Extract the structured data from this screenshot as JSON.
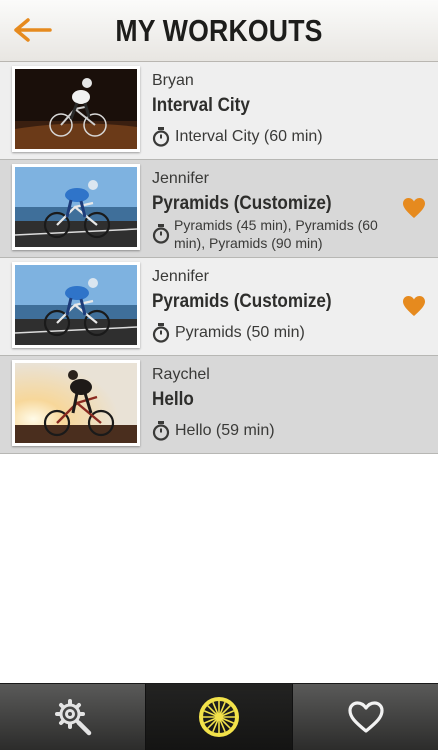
{
  "header": {
    "title": "MY WORKOUTS",
    "back_icon": "arrow-left-icon",
    "accent_color": "#e68a1e"
  },
  "workouts": [
    {
      "author": "Bryan",
      "title": "Interval City",
      "detail": "Interval City (60 min)",
      "favorite": false,
      "thumb_icon": "night-cyclist-photo"
    },
    {
      "author": "Jennifer",
      "title": "Pyramids (Customize)",
      "detail": "Pyramids (45 min), Pyramids (60 min), Pyramids (90 min)",
      "favorite": true,
      "thumb_icon": "triathlete-photo"
    },
    {
      "author": "Jennifer",
      "title": "Pyramids (Customize)",
      "detail": "Pyramids (50 min)",
      "favorite": true,
      "thumb_icon": "triathlete-photo"
    },
    {
      "author": "Raychel",
      "title": "Hello",
      "detail": "Hello (59 min)",
      "favorite": false,
      "thumb_icon": "sunset-cyclist-photo"
    }
  ],
  "tabbar": {
    "tabs": [
      {
        "icon": "gear-search-icon",
        "selected": false
      },
      {
        "icon": "wheel-icon",
        "selected": true
      },
      {
        "icon": "heart-outline-icon",
        "selected": false
      }
    ],
    "wheel_color": "#f2e24a"
  }
}
